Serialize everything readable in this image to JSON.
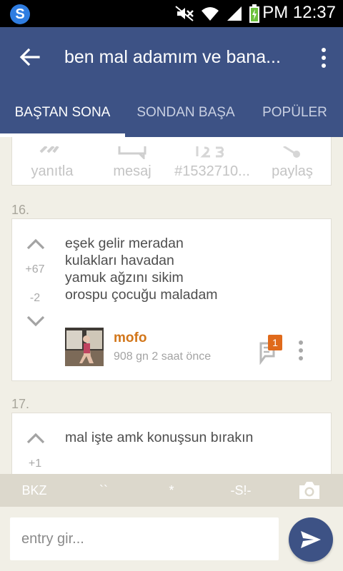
{
  "status_bar": {
    "app_icon": "S",
    "icons": [
      "mute-icon",
      "wifi-icon",
      "signal-icon",
      "battery-charging-icon"
    ],
    "time": "PM 12:37"
  },
  "toolbar": {
    "back_icon": "arrow-left-icon",
    "title": "ben mal adamım ve bana...",
    "menu_icon": "more-vertical-icon",
    "background": "#3d5285"
  },
  "tabs": [
    {
      "label": "BAŞTAN SONA",
      "active": true
    },
    {
      "label": "SONDAN BAŞA",
      "active": false
    },
    {
      "label": "POPÜLER",
      "active": false
    }
  ],
  "action_bar": [
    {
      "label": "yanıtla",
      "icon": "reply-icon"
    },
    {
      "label": "mesaj",
      "icon": "message-icon"
    },
    {
      "label": "#1532710...",
      "icon": "id-hash-icon"
    },
    {
      "label": "paylaş",
      "icon": "share-icon"
    }
  ],
  "entries": [
    {
      "number": "16.",
      "upvotes": "+67",
      "downvotes": "-2",
      "lines": [
        "eşek gelir meradan",
        "kulakları havadan",
        "yamuk ağzını sikim",
        "orospu çocuğu maladam"
      ],
      "author": "mofo",
      "time": "908 gn 2 saat  önce",
      "comment_count": "1"
    },
    {
      "number": "17.",
      "upvotes": "+1",
      "lines": [
        "mal işte amk konuşsun bırakın"
      ]
    }
  ],
  "format_bar": [
    "BKZ",
    "``",
    "*",
    "-S!-"
  ],
  "format_bar_camera_icon": "camera-icon",
  "input": {
    "placeholder": "entry gir...",
    "value": ""
  },
  "send_icon": "send-icon",
  "colors": {
    "primary": "#3d5285",
    "author": "#d2761a",
    "badge": "#e06a1b",
    "background": "#f1efe6"
  }
}
